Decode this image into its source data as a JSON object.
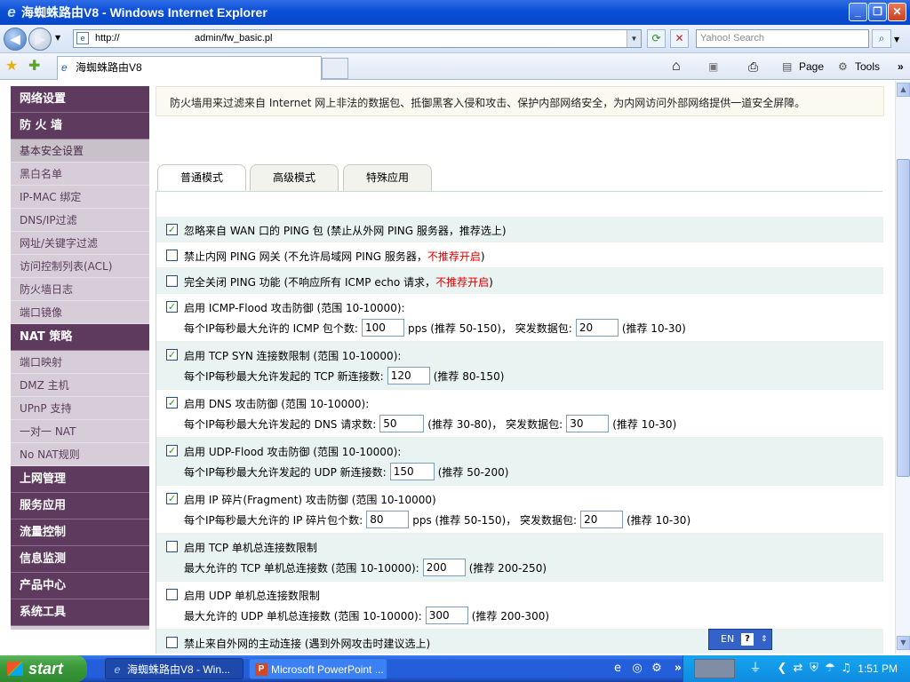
{
  "window": {
    "title": "海蜘蛛路由V8 - Windows Internet Explorer"
  },
  "browser": {
    "address_prefix": "http://",
    "address_path": "admin/fw_basic.pl",
    "search_placeholder": "Yahoo! Search",
    "tab_title": "海蜘蛛路由V8",
    "page_label": "Page",
    "tools_label": "Tools"
  },
  "sidebar": {
    "sections": [
      {
        "title": "网络设置",
        "items": []
      },
      {
        "title": "防 火 墙",
        "items": [
          "基本安全设置",
          "黑白名单",
          "IP-MAC 绑定",
          "DNS/IP过滤",
          "网址/关键字过滤",
          "访问控制列表(ACL)",
          "防火墙日志",
          "端口镜像"
        ]
      },
      {
        "title": "NAT 策略",
        "items": [
          "端口映射",
          "DMZ 主机",
          "UPnP 支持",
          "一对一 NAT",
          "No NAT规则"
        ]
      },
      {
        "title": "上网管理",
        "items": []
      },
      {
        "title": "服务应用",
        "items": []
      },
      {
        "title": "流量控制",
        "items": []
      },
      {
        "title": "信息监测",
        "items": []
      },
      {
        "title": "产品中心",
        "items": []
      },
      {
        "title": "系统工具",
        "items": []
      }
    ]
  },
  "notice": "防火墙用来过滤来自 Internet 网上非法的数据包、抵御黑客入侵和攻击、保护内部网络安全，为内网访问外部网络提供一道安全屏障。",
  "tabs": [
    "普通模式",
    "高级模式",
    "特殊应用"
  ],
  "options": {
    "o1": {
      "checked": true,
      "label": "忽略来自 WAN 口的 PING 包 (禁止从外网 PING 服务器，推荐选上)"
    },
    "o2": {
      "checked": false,
      "label": "禁止内网 PING 网关 (不允许局域网 PING 服务器，",
      "warn": "不推荐开启",
      "tail": ")"
    },
    "o3": {
      "checked": false,
      "label": "完全关闭 PING 功能 (不响应所有 ICMP echo 请求，",
      "warn": "不推荐开启",
      "tail": ")"
    },
    "o4": {
      "checked": true,
      "label": "启用 ICMP-Flood 攻击防御 (范围 10-10000):",
      "sub_a": "每个IP每秒最大允许的 ICMP 包个数:",
      "val_a": "100",
      "sub_b": "pps (推荐 50-150)， 突发数据包:",
      "val_b": "20",
      "sub_c": "(推荐 10-30)"
    },
    "o5": {
      "checked": true,
      "label": "启用 TCP SYN 连接数限制 (范围 10-10000):",
      "sub_a": "每个IP每秒最大允许发起的 TCP 新连接数:",
      "val_a": "120",
      "sub_b": "(推荐 80-150)"
    },
    "o6": {
      "checked": true,
      "label": "启用 DNS 攻击防御 (范围 10-10000):",
      "sub_a": "每个IP每秒最大允许发起的 DNS 请求数:",
      "val_a": "50",
      "sub_b": "(推荐 30-80)， 突发数据包:",
      "val_b": "30",
      "sub_c": "(推荐 10-30)"
    },
    "o7": {
      "checked": true,
      "label": "启用 UDP-Flood 攻击防御 (范围 10-10000):",
      "sub_a": "每个IP每秒最大允许发起的 UDP 新连接数:",
      "val_a": "150",
      "sub_b": "(推荐 50-200)"
    },
    "o8": {
      "checked": true,
      "label": "启用 IP 碎片(Fragment) 攻击防御 (范围 10-10000)",
      "sub_a": "每个IP每秒最大允许的 IP 碎片包个数:",
      "val_a": "80",
      "sub_b": "pps (推荐 50-150)， 突发数据包:",
      "val_b": "20",
      "sub_c": "(推荐 10-30)"
    },
    "o9": {
      "checked": false,
      "label": "启用 TCP 单机总连接数限制",
      "sub_a": "最大允许的 TCP 单机总连接数 (范围 10-10000):",
      "val_a": "200",
      "sub_b": "(推荐 200-250)"
    },
    "o10": {
      "checked": false,
      "label": "启用 UDP 单机总连接数限制",
      "sub_a": "最大允许的 UDP 单机总连接数 (范围 10-10000):",
      "val_a": "300",
      "sub_b": "(推荐 200-300)"
    },
    "o11": {
      "checked": false,
      "label": "禁止来自外网的主动连接 (遇到外网攻击时建议选上)"
    }
  },
  "langbar": {
    "lang": "EN"
  },
  "taskbar": {
    "start": "start",
    "tasks": [
      "海蜘蛛路由V8 - Win...",
      "Microsoft PowerPoint ..."
    ],
    "clock": "1:51 PM"
  }
}
